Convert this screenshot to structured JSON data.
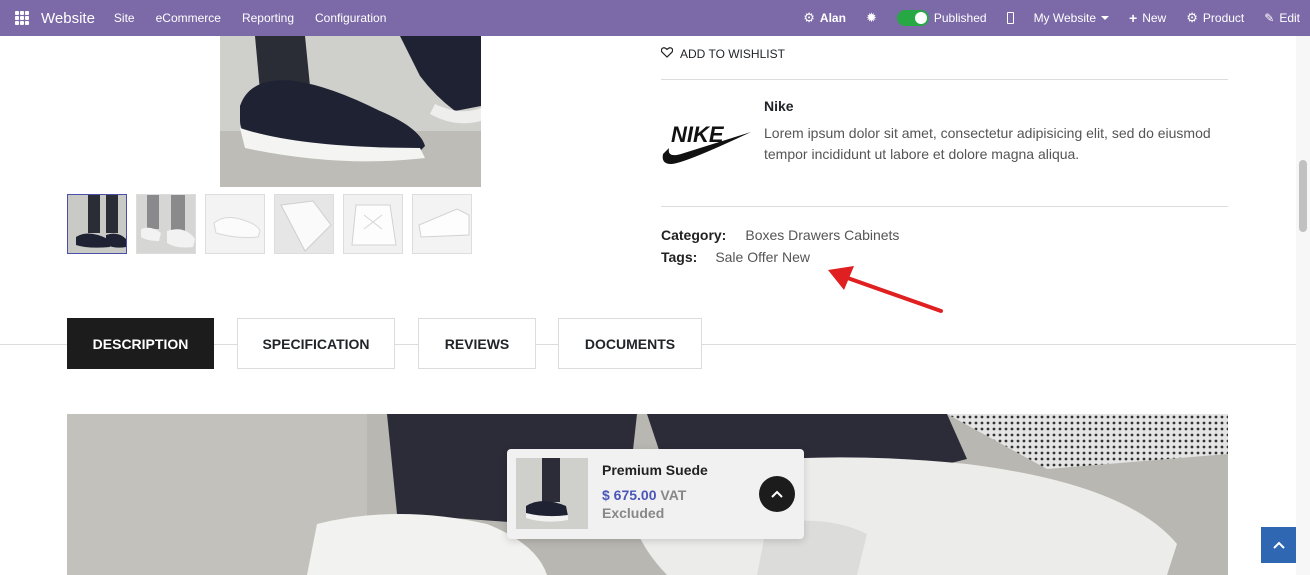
{
  "navbar": {
    "brand": "Website",
    "menu": [
      "Site",
      "eCommerce",
      "Reporting",
      "Configuration"
    ],
    "user": "Alan",
    "published_label": "Published",
    "website_label": "My Website",
    "new_label": "New",
    "product_label": "Product",
    "edit_label": "Edit"
  },
  "product": {
    "wishlist_label": "ADD TO WISHLIST",
    "brand_name": "Nike",
    "brand_logo_text": "NIKE",
    "brand_description": "Lorem ipsum dolor sit amet, consectetur adipisicing elit, sed do eiusmod tempor incididunt ut labore et dolore magna aliqua.",
    "category_label": "Category:",
    "category_value": "Boxes Drawers Cabinets",
    "tags_label": "Tags:",
    "tags_value": "Sale Offer New"
  },
  "tabs": [
    "DESCRIPTION",
    "SPECIFICATION",
    "REVIEWS",
    "DOCUMENTS"
  ],
  "sticky_card": {
    "name": "Premium Suede",
    "price": "$ 675.00",
    "vat_text": "VAT Excluded"
  },
  "colors": {
    "navbar": "#7c6aa8",
    "published_toggle": "#28a745",
    "price": "#4a56b8",
    "arrow": "#e02020",
    "scroll_top_button": "#2f67b2"
  }
}
